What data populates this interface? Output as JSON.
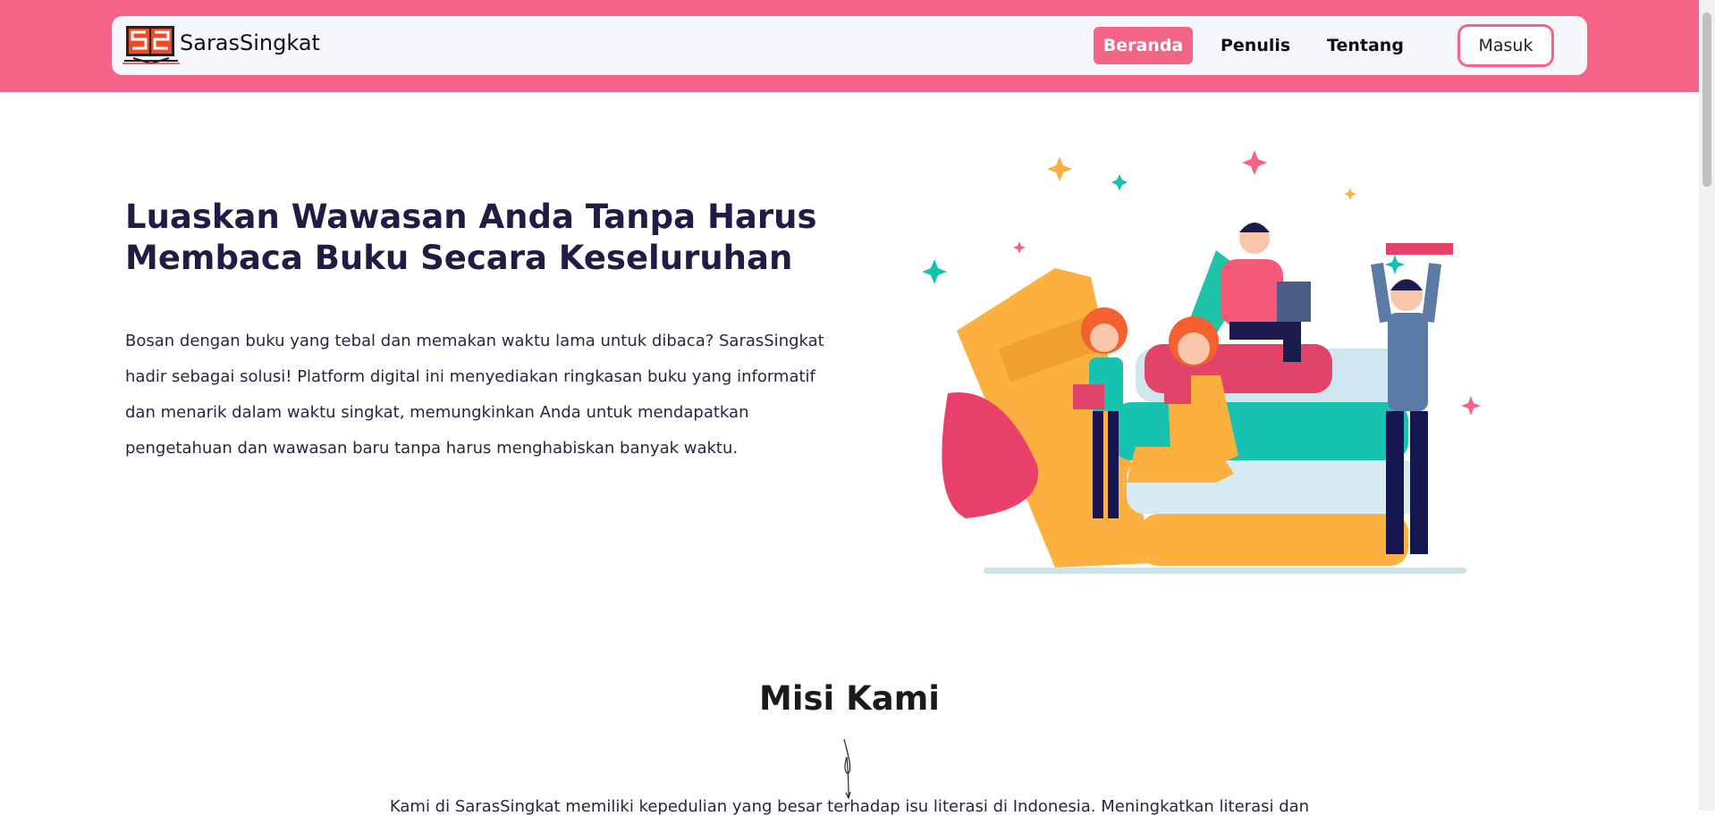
{
  "nav": {
    "brand": "SarasSingkat",
    "items": [
      {
        "label": "Beranda",
        "active": true
      },
      {
        "label": "Penulis"
      },
      {
        "label": "Tentang"
      }
    ],
    "login": "Masuk"
  },
  "hero": {
    "title": "Luaskan Wawasan Anda Tanpa Harus Membaca Buku Secara Keseluruhan",
    "body": "Bosan dengan buku yang tebal dan memakan waktu lama untuk dibaca? SarasSingkat hadir sebagai solusi! Platform digital ini menyediakan ringkasan buku yang informatif dan menarik dalam waktu singkat, memungkinkan Anda untuk mendapatkan pengetahuan dan wawasan baru tanpa harus menghabiskan banyak waktu."
  },
  "mission": {
    "title": "Misi Kami",
    "text": "Kami di SarasSingkat memiliki kepedulian yang besar terhadap isu literasi di Indonesia. Meningkatkan literasi dan"
  },
  "colors": {
    "accent": "#f46487"
  }
}
